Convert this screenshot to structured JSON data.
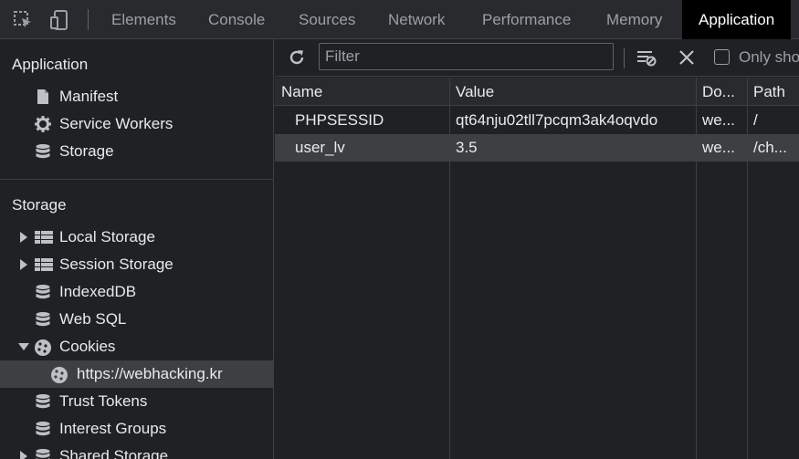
{
  "devtools": {
    "tabs": [
      "Elements",
      "Console",
      "Sources",
      "Network",
      "Performance",
      "Memory",
      "Application"
    ],
    "active_tab": "Application"
  },
  "sidebar": {
    "application_title": "Application",
    "application_items": [
      {
        "label": "Manifest",
        "icon": "document-icon"
      },
      {
        "label": "Service Workers",
        "icon": "gear-icon"
      },
      {
        "label": "Storage",
        "icon": "database-icon"
      }
    ],
    "storage_title": "Storage",
    "storage_items": [
      {
        "label": "Local Storage",
        "icon": "grid-icon",
        "expander": "collapsed"
      },
      {
        "label": "Session Storage",
        "icon": "grid-icon",
        "expander": "collapsed"
      },
      {
        "label": "IndexedDB",
        "icon": "database-icon"
      },
      {
        "label": "Web SQL",
        "icon": "database-icon"
      },
      {
        "label": "Cookies",
        "icon": "cookie-icon",
        "expander": "expanded"
      },
      {
        "label": "https://webhacking.kr",
        "icon": "cookie-icon",
        "selected": true
      },
      {
        "label": "Trust Tokens",
        "icon": "database-icon"
      },
      {
        "label": "Interest Groups",
        "icon": "database-icon"
      },
      {
        "label": "Shared Storage",
        "icon": "database-icon",
        "expander": "collapsed"
      }
    ]
  },
  "toolbar": {
    "filter_placeholder": "Filter",
    "only_show_label": "Only sho"
  },
  "table": {
    "columns": [
      "Name",
      "Value",
      "Do...",
      "Path"
    ],
    "rows": [
      {
        "name": "PHPSESSID",
        "value": "qt64nju02tll7pcqm3ak4oqvdo",
        "domain": "we...",
        "path": "/",
        "selected": false
      },
      {
        "name": "user_lv",
        "value": "3.5",
        "domain": "we...",
        "path": "/ch...",
        "selected": true
      }
    ]
  },
  "colors": {
    "background": "#202124",
    "toolbar": "#292a2d",
    "selected_row": "#3c4043",
    "active_tab": "#000000"
  }
}
